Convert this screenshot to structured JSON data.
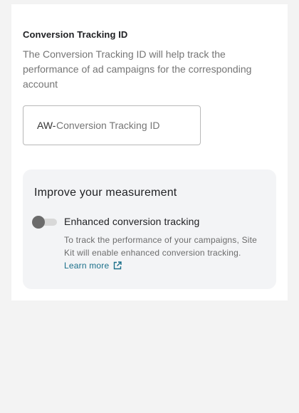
{
  "conversion_field": {
    "title": "Conversion Tracking ID",
    "description": "The Conversion Tracking ID will help track the performance of ad campaigns for the corresponding account",
    "prefix": "AW-",
    "value": "",
    "placeholder": "Conversion Tracking ID"
  },
  "measurement_panel": {
    "title": "Improve your measurement",
    "toggle_label": "Enhanced conversion tracking",
    "toggle_on": false,
    "help_text": "To track the performance of your campaigns, Site Kit will enable enhanced conversion tracking.",
    "learn_more_label": "Learn more",
    "link_icon": "external-link-icon"
  },
  "colors": {
    "page_background": "#f3f3f3",
    "card_background": "#ffffff",
    "panel_background": "#f3f4f6",
    "link": "#1a6f8a",
    "toggle_thumb_off": "#6b6b6b",
    "toggle_track_off": "#d8d8d8"
  }
}
